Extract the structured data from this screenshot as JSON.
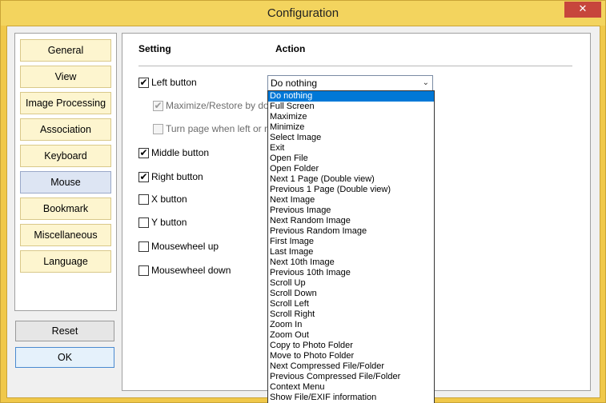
{
  "window": {
    "title": "Configuration",
    "close_glyph": "✕"
  },
  "sidebar": {
    "items": [
      {
        "label": "General"
      },
      {
        "label": "View"
      },
      {
        "label": "Image Processing"
      },
      {
        "label": "Association"
      },
      {
        "label": "Keyboard"
      },
      {
        "label": "Mouse",
        "active": true
      },
      {
        "label": "Bookmark"
      },
      {
        "label": "Miscellaneous"
      },
      {
        "label": "Language"
      }
    ],
    "reset_label": "Reset",
    "ok_label": "OK"
  },
  "mouse": {
    "setting_header": "Setting",
    "action_header": "Action",
    "rows": [
      {
        "label": "Left button",
        "checked": true
      },
      {
        "label": "Maximize/Restore by doubl",
        "checked": true,
        "disabled": true
      },
      {
        "label": "Turn page when left or righ",
        "checked": false,
        "disabled": true
      },
      {
        "label": "Middle button",
        "checked": true
      },
      {
        "label": "Right button",
        "checked": true
      },
      {
        "label": "X button",
        "checked": false
      },
      {
        "label": "Y button",
        "checked": false
      },
      {
        "label": "Mousewheel up",
        "checked": false
      },
      {
        "label": "Mousewheel down",
        "checked": false
      }
    ],
    "check_glyph": "✔",
    "combo_value": "Do nothing",
    "combo_arrow": "⌄",
    "dropdown_options": [
      "Do nothing",
      "Full Screen",
      "Maximize",
      "Minimize",
      "Select Image",
      "Exit",
      "Open File",
      "Open Folder",
      "Next 1 Page (Double view)",
      "Previous 1 Page (Double view)",
      "Next Image",
      "Previous Image",
      "Next Random Image",
      "Previous Random Image",
      "First Image",
      "Last Image",
      "Next 10th Image",
      "Previous 10th Image",
      "Scroll Up",
      "Scroll Down",
      "Scroll Left",
      "Scroll Right",
      "Zoom In",
      "Zoom Out",
      "Copy to Photo Folder",
      "Move to Photo Folder",
      "Next Compressed File/Folder",
      "Previous Compressed File/Folder",
      "Context Menu",
      "Show File/EXIF information"
    ],
    "selected_option": "Do nothing"
  }
}
